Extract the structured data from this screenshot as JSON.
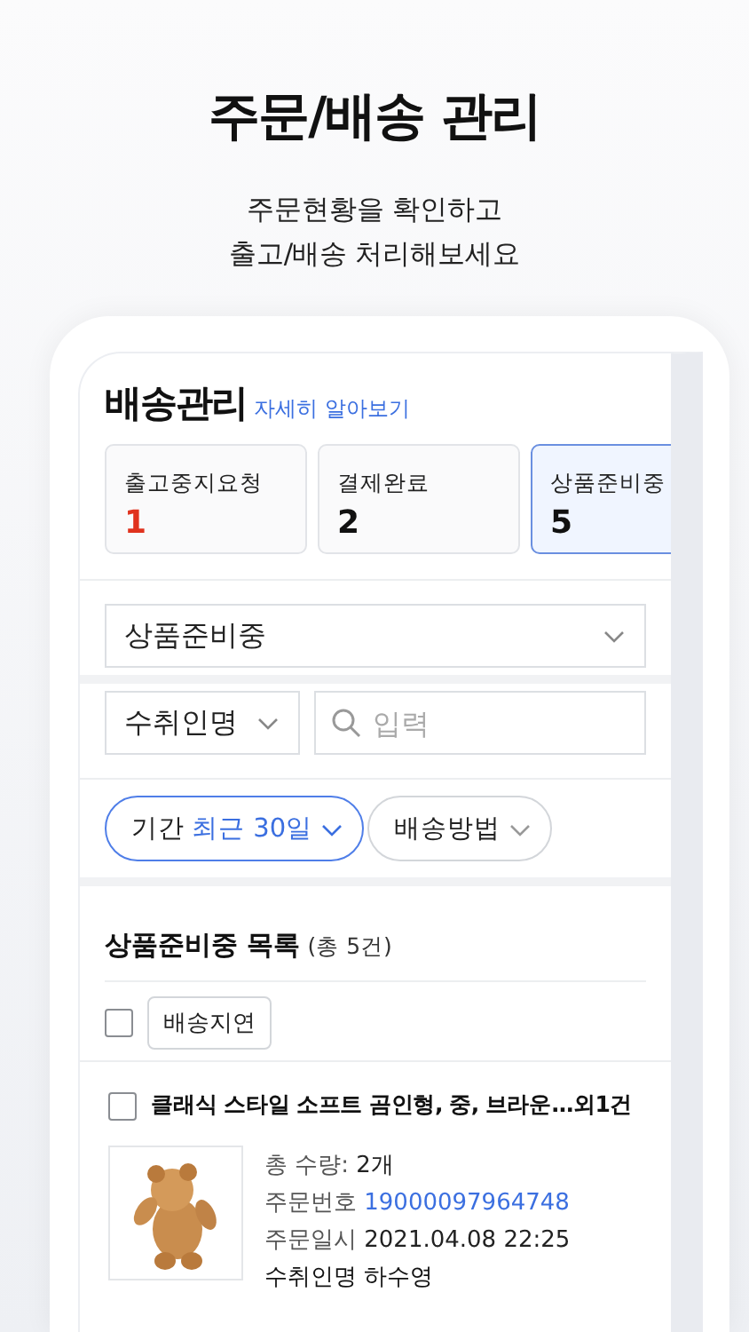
{
  "headline": "주문/배송 관리",
  "subtitle_lines": [
    "주문현황을 확인하고",
    "출고/배송 처리해보세요"
  ],
  "screen": {
    "title": "배송관리",
    "help_link": "자세히 알아보기",
    "status_cards": [
      {
        "label": "출고중지요청",
        "count": "1",
        "alert": true,
        "selected": false
      },
      {
        "label": "결제완료",
        "count": "2",
        "alert": false,
        "selected": false
      },
      {
        "label": "상품준비중",
        "count": "5",
        "alert": false,
        "selected": true
      }
    ],
    "status_select": {
      "value": "상품준비중"
    },
    "search_type_select": {
      "value": "수취인명"
    },
    "search_field": {
      "placeholder": "입력"
    },
    "filters": [
      {
        "label": "기간",
        "value": "최근 30일",
        "selected": true
      },
      {
        "label": "배송방법",
        "selected": false
      }
    ],
    "list": {
      "title": "상품준비중 목록",
      "count": "(총 5건)",
      "select_all": {
        "checked": false
      },
      "bulk_button": "배송지연",
      "orders": [
        {
          "checked": false,
          "title": "클래식 스타일 소프트 곰인형, 중, 브라운...외1건",
          "details": [
            {
              "label": "총 수량:",
              "value": "2개",
              "kind": "plain"
            },
            {
              "label": "주문번호",
              "value": "19000097964748",
              "kind": "link"
            },
            {
              "label": "주문일시",
              "value": "2021.04.08 22:25",
              "kind": "plain"
            },
            {
              "label": "수취인명",
              "value": "하수영",
              "kind": "strong"
            }
          ]
        }
      ]
    }
  }
}
